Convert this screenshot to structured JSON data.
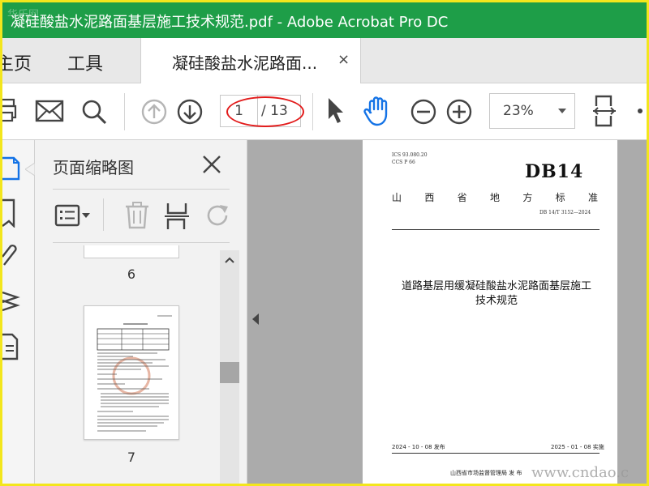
{
  "window": {
    "title": "凝硅酸盐水泥路面基层施工技术规范.pdf - Adobe Acrobat Pro DC",
    "watermark_top": "华乐网"
  },
  "tabs": {
    "home": "主页",
    "tools": "工具",
    "document": "凝硅酸盐水泥路面...",
    "close_glyph": "×"
  },
  "toolbar": {
    "current_page": "1",
    "total_pages": "/ 13",
    "zoom": "23%",
    "icons": [
      "print-icon",
      "email-icon",
      "search-icon",
      "prev-page-icon",
      "next-page-icon",
      "select-arrow-icon",
      "hand-tool-icon",
      "zoom-out-icon",
      "zoom-in-icon",
      "fit-page-icon",
      "more-icon"
    ]
  },
  "panel": {
    "title": "页面缩略图",
    "thumbnails": [
      {
        "page": "6"
      },
      {
        "page": "7"
      }
    ]
  },
  "document": {
    "ics": "ICS  93.080.20",
    "ccs": "CCS  P 66",
    "db": "DB14",
    "province": [
      "山",
      "西",
      "省",
      "地",
      "方",
      "标",
      "准"
    ],
    "standard_no": "DB 14/T  3152—2024",
    "title_line1": "道路基层用缓凝硅酸盐水泥路面基层施工",
    "title_line2": "技术规范",
    "publish_date": "2024 - 10 - 08 发布",
    "implement_date": "2025 - 01 - 08 实施",
    "issuer": "山西省市场监督管理局    发  布"
  },
  "site_watermark": "www.cndao.c",
  "colors": {
    "titlebar": "#1e9e48",
    "accent": "#1473e6",
    "highlight_oval": "#e21b1b",
    "border": "#f3e61c"
  }
}
